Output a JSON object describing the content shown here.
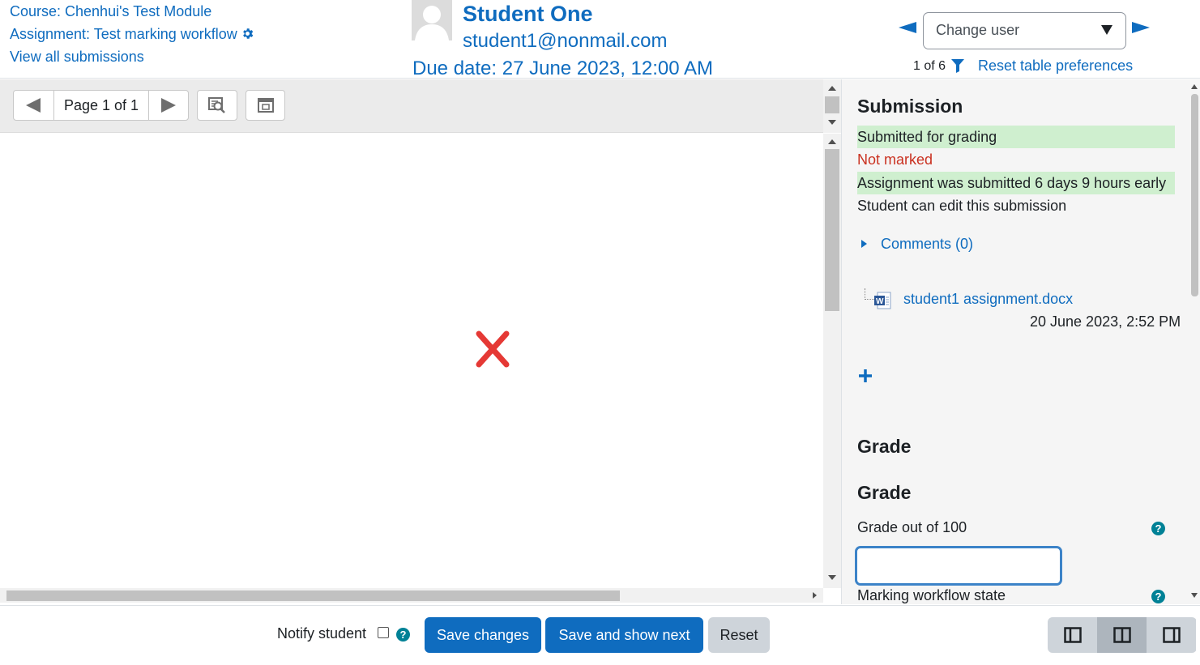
{
  "header": {
    "course_link": "Course: Chenhui's Test Module",
    "assignment_link": "Assignment: Test marking workflow",
    "view_all_link": "View all submissions",
    "student_name": "Student One",
    "student_email": "student1@nonmail.com",
    "due_date": "Due date: 27 June 2023, 12:00 AM",
    "change_user_placeholder": "Change user",
    "user_count": "1 of 6",
    "reset_prefs_link": "Reset table preferences"
  },
  "toolbar": {
    "page_label": "Page 1 of 1"
  },
  "submission": {
    "heading": "Submission",
    "status_submitted": "Submitted for grading",
    "status_marked": "Not marked",
    "status_timing": "Assignment was submitted 6 days 9 hours early",
    "status_edit": "Student can edit this submission",
    "comments_label": "Comments (0)",
    "file_name": "student1 assignment.docx",
    "file_date": "20 June 2023, 2:52 PM"
  },
  "grade": {
    "section_heading": "Grade",
    "subheading": "Grade",
    "grade_label": "Grade out of 100",
    "grade_value": "",
    "workflow_label": "Marking workflow state"
  },
  "footer": {
    "notify_label": "Notify student",
    "save_label": "Save changes",
    "save_next_label": "Save and show next",
    "reset_label": "Reset"
  },
  "colors": {
    "link": "#0f6cbf",
    "primary_button": "#0f6cbf",
    "status_ok_bg": "#cfefcf",
    "status_error_text": "#ca3120",
    "help_icon": "#008196"
  },
  "icons": {
    "assignment_settings": "gear-icon",
    "filter": "filter-icon",
    "broken_image": "broken-image-icon",
    "file": "word-document-icon",
    "add": "plus-icon",
    "help": "help-icon"
  }
}
